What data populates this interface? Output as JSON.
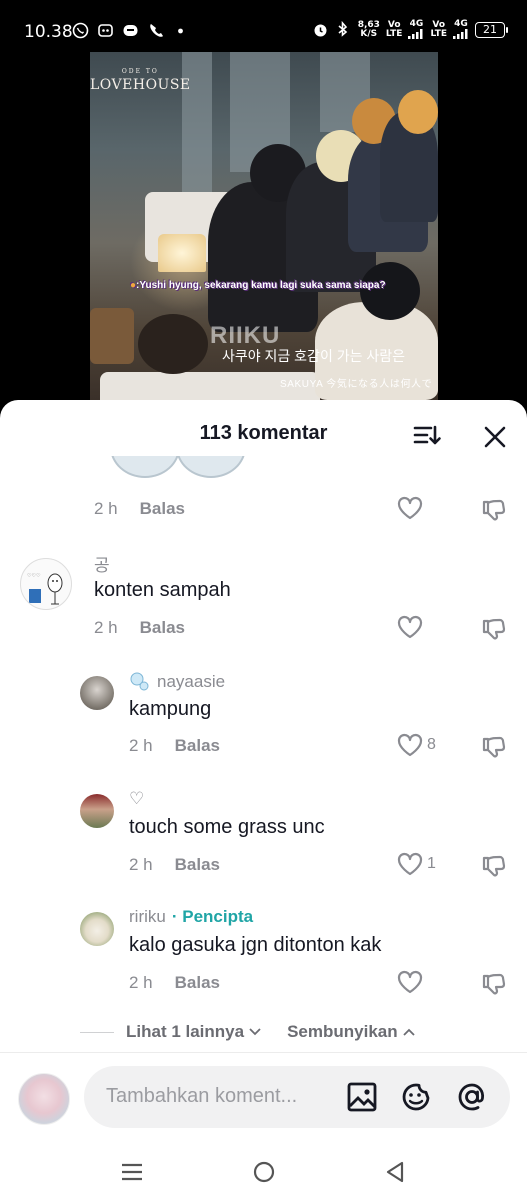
{
  "status_bar": {
    "time": "10.38",
    "speed": "8,63",
    "speed_unit": "K/S",
    "net1_top": "Vo",
    "net1_bottom": "LTE",
    "net1_gen": "4G",
    "net2_top": "Vo",
    "net2_bottom": "LTE",
    "net2_gen": "4G",
    "battery": "21"
  },
  "video": {
    "brand_small": "ODE TO",
    "brand_main": "LOVEHOUSE",
    "subtitle_indonesian": ":Yushi hyung, sekarang kamu lagi suka sama siapa?",
    "subtitle_korean": "사쿠야 지금 호감이 가는 사람은",
    "subtitle_japanese": "SAKUYA  今気になる人は何人で",
    "watermark": "RIIKU"
  },
  "sheet": {
    "title": "113 komentar",
    "accent": "#20a5a6"
  },
  "comments": [
    {
      "time": "2 h",
      "reply": "Balas"
    },
    {
      "user": "공",
      "text": "konten sampah",
      "time": "2 h",
      "reply": "Balas"
    },
    {
      "user": "nayaasie",
      "text": "kampung",
      "time": "2 h",
      "reply": "Balas",
      "likes": "8"
    },
    {
      "user": "♡",
      "text": "touch some grass unc",
      "time": "2 h",
      "reply": "Balas",
      "likes": "1"
    },
    {
      "user": "ririku",
      "badge": "· Pencipta",
      "text": "kalo gasuka jgn ditonton kak",
      "time": "2 h",
      "reply": "Balas"
    }
  ],
  "thread": {
    "view_more": "Lihat 1 lainnya",
    "hide": "Sembunyikan"
  },
  "composer": {
    "placeholder": "Tambahkan koment..."
  }
}
